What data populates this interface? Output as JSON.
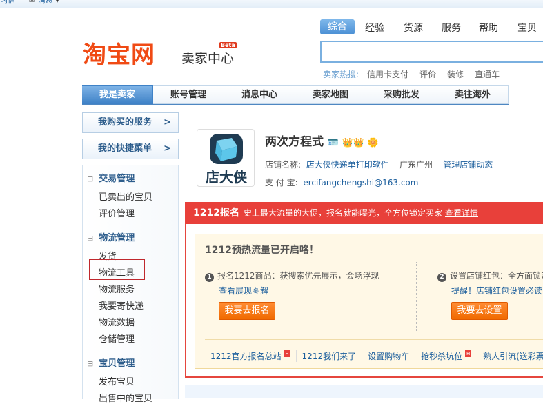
{
  "topbar": {
    "mail": "内信",
    "messages": "消息"
  },
  "logo": {
    "brand": "淘宝网",
    "sub": "卖家中心",
    "badge": "Beta"
  },
  "search": {
    "tabs": [
      "综合",
      "经验",
      "货源",
      "服务",
      "帮助",
      "宝贝"
    ],
    "value": "",
    "hot_label": "卖家热搜:",
    "hot": [
      "信用卡支付",
      "评价",
      "装修",
      "直通车"
    ]
  },
  "nav": [
    "我是卖家",
    "账号管理",
    "消息中心",
    "卖家地图",
    "采购批发",
    "卖往海外"
  ],
  "sidebar": {
    "buttons": [
      {
        "label": "我购买的服务",
        "arrow": ">"
      },
      {
        "label": "我的快捷菜单",
        "arrow": ">"
      }
    ],
    "sections": [
      {
        "title": "交易管理",
        "items": [
          "已卖出的宝贝",
          "评价管理"
        ]
      },
      {
        "title": "物流管理",
        "items": [
          "发货",
          "物流工具",
          "物流服务",
          "我要寄快递",
          "物流数据",
          "仓储管理"
        ]
      },
      {
        "title": "宝贝管理",
        "items": [
          "发布宝贝",
          "出售中的宝贝"
        ]
      }
    ],
    "collapse_icon": "⊟"
  },
  "profile": {
    "avatar_text": "店大侠",
    "name": "两次方程式",
    "shop_label": "店铺名称:",
    "shop_name": "店大侠快递单打印软件",
    "location": "广东广州",
    "manage": "管理店铺动态",
    "alipay_label": "支 付 宝:",
    "alipay": "ercifangchengshi@163.com"
  },
  "banner": {
    "title": "1212报名",
    "desc": "史上最大流量的大促，报名就能曝光，全方位锁定买家",
    "detail": "查看详情",
    "inner_title": "1212预热流量已开启咯！",
    "steps": [
      {
        "num": "1",
        "text": "报名1212商品：获搜索优先展示，会场浮现",
        "link": "查看展现图解",
        "button": "我要去报名"
      },
      {
        "num": "2",
        "text": "设置店铺红包：全方面锁定",
        "link": "提醒！店铺红包设置必读",
        "button": "我要去设置"
      }
    ],
    "links": [
      {
        "text": "1212官方报名总站",
        "hot": true
      },
      {
        "text": "1212我们来了",
        "hot": false
      },
      {
        "text": "设置购物车",
        "hot": false
      },
      {
        "text": "抢秒杀坑位",
        "hot": true
      },
      {
        "text": "熟人引流(送彩票",
        "hot": false
      }
    ],
    "hot_badge": "H"
  }
}
